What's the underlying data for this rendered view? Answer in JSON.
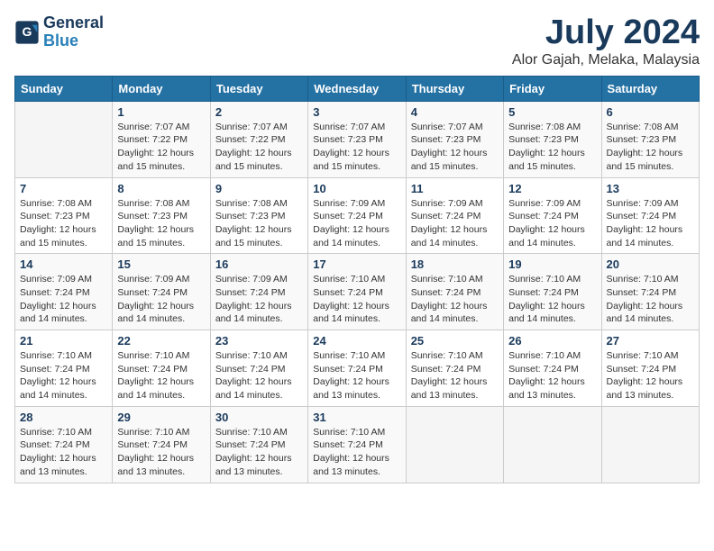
{
  "header": {
    "logo_line1": "General",
    "logo_line2": "Blue",
    "month_title": "July 2024",
    "location": "Alor Gajah, Melaka, Malaysia"
  },
  "weekdays": [
    "Sunday",
    "Monday",
    "Tuesday",
    "Wednesday",
    "Thursday",
    "Friday",
    "Saturday"
  ],
  "weeks": [
    [
      {
        "day": null
      },
      {
        "day": "1",
        "sunrise": "7:07 AM",
        "sunset": "7:22 PM",
        "daylight": "12 hours and 15 minutes."
      },
      {
        "day": "2",
        "sunrise": "7:07 AM",
        "sunset": "7:22 PM",
        "daylight": "12 hours and 15 minutes."
      },
      {
        "day": "3",
        "sunrise": "7:07 AM",
        "sunset": "7:23 PM",
        "daylight": "12 hours and 15 minutes."
      },
      {
        "day": "4",
        "sunrise": "7:07 AM",
        "sunset": "7:23 PM",
        "daylight": "12 hours and 15 minutes."
      },
      {
        "day": "5",
        "sunrise": "7:08 AM",
        "sunset": "7:23 PM",
        "daylight": "12 hours and 15 minutes."
      },
      {
        "day": "6",
        "sunrise": "7:08 AM",
        "sunset": "7:23 PM",
        "daylight": "12 hours and 15 minutes."
      }
    ],
    [
      {
        "day": "7",
        "sunrise": "7:08 AM",
        "sunset": "7:23 PM",
        "daylight": "12 hours and 15 minutes."
      },
      {
        "day": "8",
        "sunrise": "7:08 AM",
        "sunset": "7:23 PM",
        "daylight": "12 hours and 15 minutes."
      },
      {
        "day": "9",
        "sunrise": "7:08 AM",
        "sunset": "7:23 PM",
        "daylight": "12 hours and 15 minutes."
      },
      {
        "day": "10",
        "sunrise": "7:09 AM",
        "sunset": "7:24 PM",
        "daylight": "12 hours and 14 minutes."
      },
      {
        "day": "11",
        "sunrise": "7:09 AM",
        "sunset": "7:24 PM",
        "daylight": "12 hours and 14 minutes."
      },
      {
        "day": "12",
        "sunrise": "7:09 AM",
        "sunset": "7:24 PM",
        "daylight": "12 hours and 14 minutes."
      },
      {
        "day": "13",
        "sunrise": "7:09 AM",
        "sunset": "7:24 PM",
        "daylight": "12 hours and 14 minutes."
      }
    ],
    [
      {
        "day": "14",
        "sunrise": "7:09 AM",
        "sunset": "7:24 PM",
        "daylight": "12 hours and 14 minutes."
      },
      {
        "day": "15",
        "sunrise": "7:09 AM",
        "sunset": "7:24 PM",
        "daylight": "12 hours and 14 minutes."
      },
      {
        "day": "16",
        "sunrise": "7:09 AM",
        "sunset": "7:24 PM",
        "daylight": "12 hours and 14 minutes."
      },
      {
        "day": "17",
        "sunrise": "7:10 AM",
        "sunset": "7:24 PM",
        "daylight": "12 hours and 14 minutes."
      },
      {
        "day": "18",
        "sunrise": "7:10 AM",
        "sunset": "7:24 PM",
        "daylight": "12 hours and 14 minutes."
      },
      {
        "day": "19",
        "sunrise": "7:10 AM",
        "sunset": "7:24 PM",
        "daylight": "12 hours and 14 minutes."
      },
      {
        "day": "20",
        "sunrise": "7:10 AM",
        "sunset": "7:24 PM",
        "daylight": "12 hours and 14 minutes."
      }
    ],
    [
      {
        "day": "21",
        "sunrise": "7:10 AM",
        "sunset": "7:24 PM",
        "daylight": "12 hours and 14 minutes."
      },
      {
        "day": "22",
        "sunrise": "7:10 AM",
        "sunset": "7:24 PM",
        "daylight": "12 hours and 14 minutes."
      },
      {
        "day": "23",
        "sunrise": "7:10 AM",
        "sunset": "7:24 PM",
        "daylight": "12 hours and 14 minutes."
      },
      {
        "day": "24",
        "sunrise": "7:10 AM",
        "sunset": "7:24 PM",
        "daylight": "12 hours and 13 minutes."
      },
      {
        "day": "25",
        "sunrise": "7:10 AM",
        "sunset": "7:24 PM",
        "daylight": "12 hours and 13 minutes."
      },
      {
        "day": "26",
        "sunrise": "7:10 AM",
        "sunset": "7:24 PM",
        "daylight": "12 hours and 13 minutes."
      },
      {
        "day": "27",
        "sunrise": "7:10 AM",
        "sunset": "7:24 PM",
        "daylight": "12 hours and 13 minutes."
      }
    ],
    [
      {
        "day": "28",
        "sunrise": "7:10 AM",
        "sunset": "7:24 PM",
        "daylight": "12 hours and 13 minutes."
      },
      {
        "day": "29",
        "sunrise": "7:10 AM",
        "sunset": "7:24 PM",
        "daylight": "12 hours and 13 minutes."
      },
      {
        "day": "30",
        "sunrise": "7:10 AM",
        "sunset": "7:24 PM",
        "daylight": "12 hours and 13 minutes."
      },
      {
        "day": "31",
        "sunrise": "7:10 AM",
        "sunset": "7:24 PM",
        "daylight": "12 hours and 13 minutes."
      },
      {
        "day": null
      },
      {
        "day": null
      },
      {
        "day": null
      }
    ]
  ],
  "labels": {
    "sunrise": "Sunrise:",
    "sunset": "Sunset:",
    "daylight": "Daylight:"
  }
}
